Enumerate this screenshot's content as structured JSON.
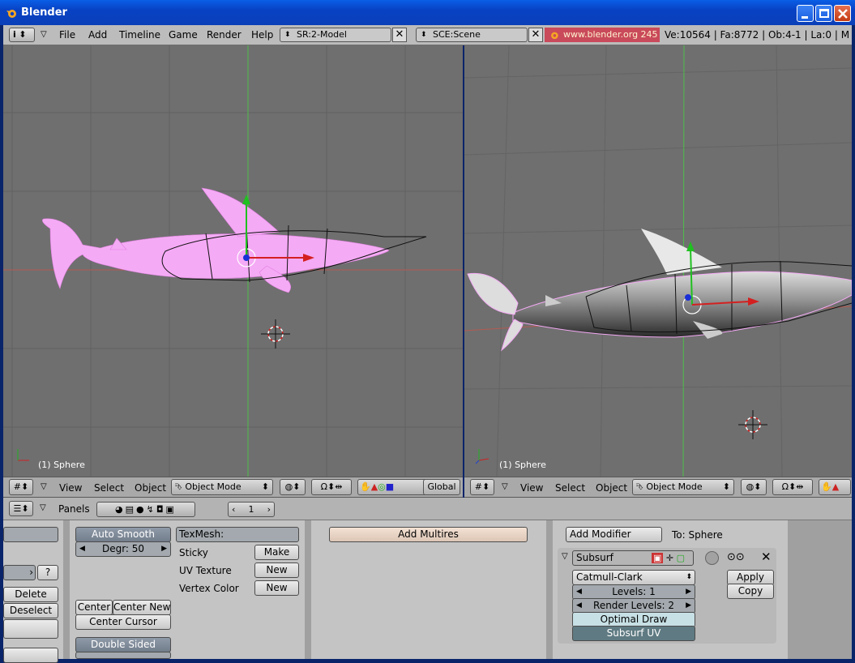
{
  "window": {
    "title": "Blender"
  },
  "infobar": {
    "menu": [
      "File",
      "Add",
      "Timeline",
      "Game",
      "Render",
      "Help"
    ],
    "screen": "SR:2-Model",
    "scene": "SCE:Scene",
    "url": "www.blender.org 245",
    "stats": "Ve:10564 | Fa:8772 | Ob:4-1 | La:0 | M"
  },
  "viewport_left": {
    "label": "(1) Sphere",
    "header": {
      "view": "View",
      "select": "Select",
      "object": "Object",
      "mode": "Object Mode",
      "orientation": "Global"
    }
  },
  "viewport_right": {
    "label": "(1) Sphere",
    "header": {
      "view": "View",
      "select": "Select",
      "object": "Object",
      "mode": "Object Mode"
    }
  },
  "buttons_window": {
    "panels_label": "Panels",
    "frame": "1",
    "link_panel": {
      "help": "?",
      "delete": "Delete",
      "deselect": "Deselect"
    },
    "shading_panel": {
      "auto_smooth": "Auto Smooth",
      "degr": "Degr: 50",
      "center": "Center",
      "center_new": "Center New",
      "center_cursor": "Center Cursor",
      "double_sided": "Double Sided"
    },
    "mesh_panel": {
      "texmesh": "TexMesh:",
      "sticky": "Sticky",
      "sticky_btn": "Make",
      "uv_texture": "UV Texture",
      "uv_btn": "New",
      "vertex_color": "Vertex Color",
      "vcol_btn": "New"
    },
    "multires_panel": {
      "add_multires": "Add Multires"
    },
    "modifiers_panel": {
      "add_modifier": "Add Modifier",
      "to": "To: Sphere",
      "modifier_name": "Subsurf",
      "type": "Catmull-Clark",
      "levels": "Levels: 1",
      "render_levels": "Render Levels: 2",
      "optimal_draw": "Optimal Draw",
      "subsurf_uv": "Subsurf UV",
      "apply": "Apply",
      "copy": "Copy"
    }
  },
  "colors": {
    "selection": "#f5aaf5",
    "grid": "#6f6f6f",
    "x_axis": "#c0392b",
    "y_axis": "#2ecc40"
  },
  "icons": [
    "blender-logo-icon",
    "info-menu-icon",
    "screen-browse-icon",
    "close-icon",
    "scene-browse-icon",
    "grid-icon",
    "object-mode-icon",
    "draw-type-icon",
    "magnet-icon",
    "layer-icon",
    "hand-icon",
    "rotate-icon",
    "scale-icon",
    "panels-icon"
  ]
}
